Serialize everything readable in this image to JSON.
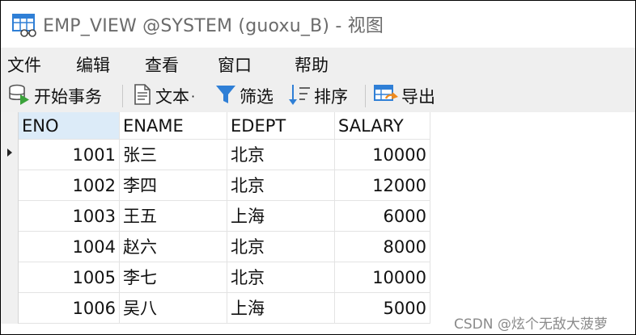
{
  "window": {
    "title": "EMP_VIEW @SYSTEM (guoxu_B) - 视图"
  },
  "menu": {
    "items": [
      "文件",
      "编辑",
      "查看",
      "窗口",
      "帮助"
    ]
  },
  "toolbar": {
    "begin_transaction": "开始事务",
    "text": "文本",
    "text_dropdown": "·",
    "filter": "筛选",
    "sort": "排序",
    "export": "导出"
  },
  "table": {
    "columns": [
      "ENO",
      "ENAME",
      "EDEPT",
      "SALARY"
    ],
    "rows": [
      [
        "1001",
        "张三",
        "北京",
        "10000"
      ],
      [
        "1002",
        "李四",
        "北京",
        "12000"
      ],
      [
        "1003",
        "王五",
        "上海",
        "6000"
      ],
      [
        "1004",
        "赵六",
        "北京",
        "8000"
      ],
      [
        "1005",
        "李七",
        "北京",
        "10000"
      ],
      [
        "1006",
        "吴八",
        "上海",
        "5000"
      ]
    ]
  },
  "watermark": "CSDN @炫个无敌大菠萝",
  "colors": {
    "selected_header": "#dcebf8",
    "menubar_bg": "#efefef",
    "icon_blue": "#2f7fd6",
    "icon_orange": "#f08a1c"
  }
}
